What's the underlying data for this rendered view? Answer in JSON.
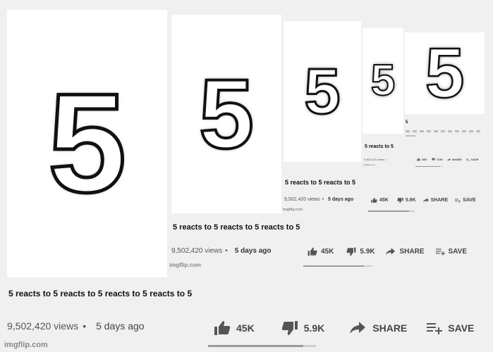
{
  "levels": [
    {
      "big_digit": "5",
      "title": "5 reacts to 5  reacts to 5 reacts to 5 reacts to 5",
      "views": "9,502,420 views",
      "dot": "•",
      "date": "5 days ago",
      "like_count": "45K",
      "dislike_count": "5.9K",
      "share_label": "SHARE",
      "save_label": "SAVE",
      "more_label": "•••",
      "credit": "imgflip.com",
      "like_ratio": 0.88
    },
    {
      "big_digit": "5",
      "title": "5 reacts to 5  reacts to 5 reacts to 5",
      "views": "9,502,420 views",
      "dot": "•",
      "date": "5 days ago",
      "like_count": "45K",
      "dislike_count": "5.9K",
      "share_label": "SHARE",
      "save_label": "SAVE",
      "credit": "imgflip.com",
      "like_ratio": 0.88
    },
    {
      "big_digit": "5",
      "title": "5 reacts to 5  reacts to 5",
      "views": "9,502,420 views",
      "dot": "•",
      "date": "5 days ago",
      "like_count": "45K",
      "dislike_count": "5.9K",
      "share_label": "SHARE",
      "save_label": "SAVE",
      "credit": "imgflip.com",
      "like_ratio": 0.88
    },
    {
      "big_digit": "5",
      "title": "5 reacts to 5",
      "views": "9,502,420 views",
      "dot": "•",
      "like_count": "45K",
      "dislike_count": "5.9K",
      "share_label": "SHARE",
      "save_label": "SAVE",
      "credit": "imgflip.com",
      "like_ratio": 0.88
    },
    {
      "big_digit": "5",
      "title": "5"
    }
  ]
}
